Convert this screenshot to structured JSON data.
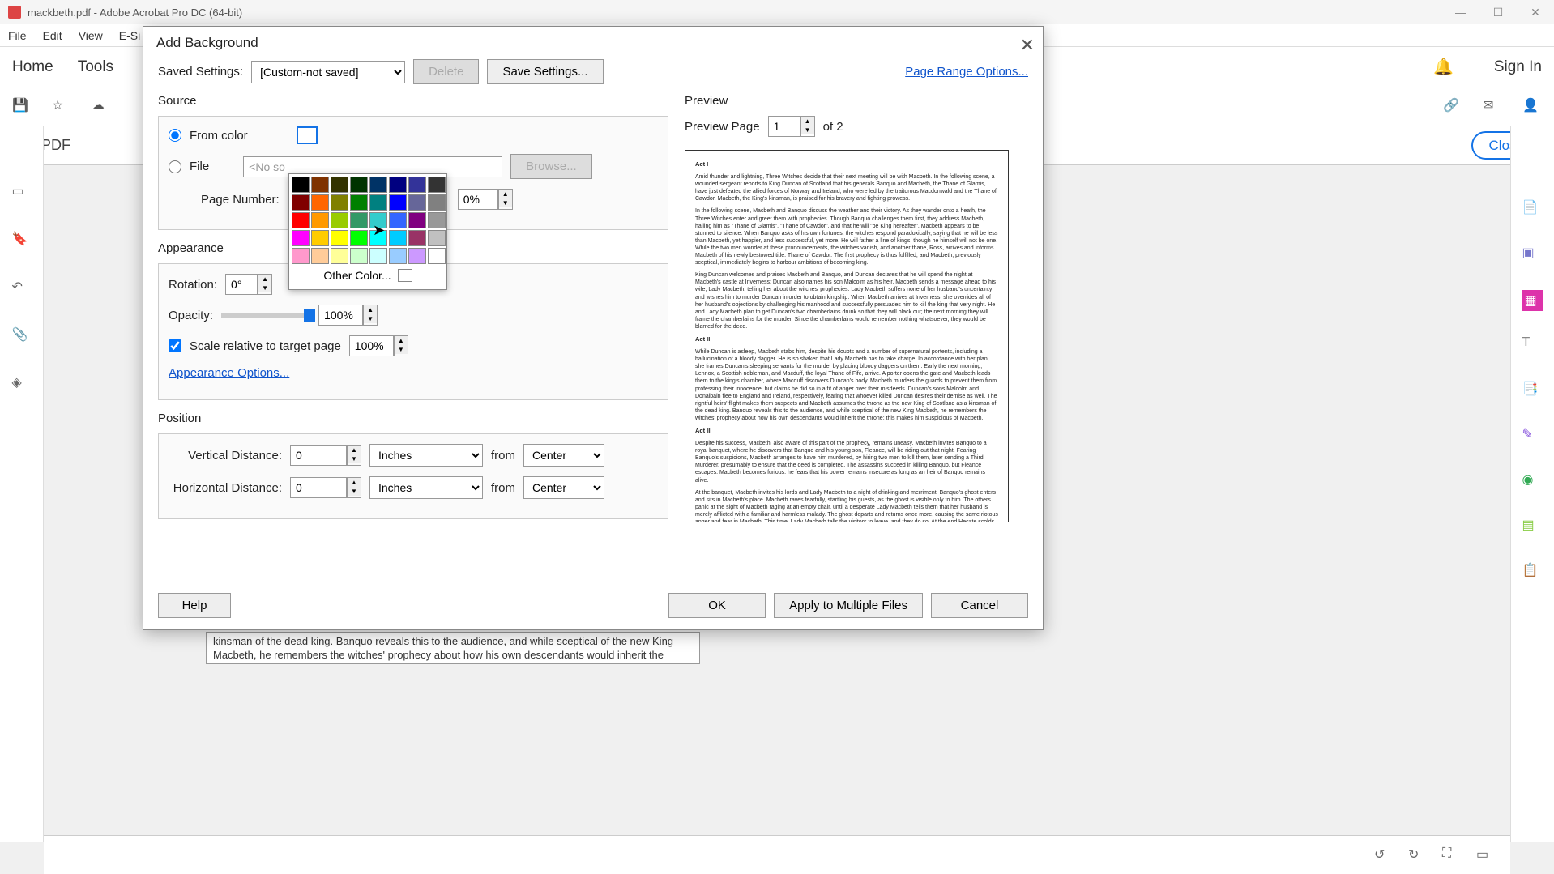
{
  "titlebar": {
    "title": "mackbeth.pdf - Adobe Acrobat Pro DC (64-bit)"
  },
  "menubar": {
    "file": "File",
    "edit": "Edit",
    "view": "View",
    "esign": "E-Si"
  },
  "tabbar": {
    "home": "Home",
    "tools": "Tools",
    "signin": "Sign In"
  },
  "editbar": {
    "label": "Edit PDF",
    "close": "Close"
  },
  "dialog": {
    "title": "Add Background",
    "saved_settings_label": "Saved Settings:",
    "saved_settings_value": "[Custom-not saved]",
    "delete": "Delete",
    "save_settings": "Save Settings...",
    "page_range": "Page Range Options...",
    "source": {
      "label": "Source",
      "from_color": "From color",
      "file": "File",
      "file_value": "<No so",
      "browse": "Browse...",
      "page_number_label": "Page Number:",
      "page_number_pct": "0%"
    },
    "appearance": {
      "label": "Appearance",
      "rotation_label": "Rotation:",
      "rotation_value": "0°",
      "opacity_label": "Opacity:",
      "opacity_value": "100%",
      "scale_label": "Scale relative to target page",
      "scale_value": "100%",
      "options": "Appearance Options..."
    },
    "position": {
      "label": "Position",
      "vdist_label": "Vertical Distance:",
      "vdist_value": "0",
      "hdist_label": "Horizontal Distance:",
      "hdist_value": "0",
      "unit": "Inches",
      "from": "from",
      "origin": "Center"
    },
    "help": "Help",
    "ok": "OK",
    "apply_multi": "Apply to Multiple Files",
    "cancel": "Cancel",
    "preview": {
      "label": "Preview",
      "page_label": "Preview Page",
      "page_value": "1",
      "of": "of 2"
    }
  },
  "colorpicker": {
    "other": "Other Color...",
    "rows": [
      [
        "#000000",
        "#7f3300",
        "#333300",
        "#003300",
        "#003366",
        "#000080",
        "#333399",
        "#333333"
      ],
      [
        "#800000",
        "#ff6600",
        "#808000",
        "#008000",
        "#008080",
        "#0000ff",
        "#666699",
        "#808080"
      ],
      [
        "#ff0000",
        "#ff9900",
        "#99cc00",
        "#339966",
        "#33cccc",
        "#3366ff",
        "#800080",
        "#999999"
      ],
      [
        "#ff00ff",
        "#ffcc00",
        "#ffff00",
        "#00ff00",
        "#00ffff",
        "#00ccff",
        "#993366",
        "#c0c0c0"
      ],
      [
        "#ff99cc",
        "#ffcc99",
        "#ffff99",
        "#ccffcc",
        "#ccffff",
        "#99ccff",
        "#cc99ff",
        "#ffffff"
      ]
    ]
  },
  "preview_doc": {
    "act1_h": "Act I",
    "act1_p1": "Amid thunder and lightning, Three Witches decide that their next meeting will be with Macbeth. In the following scene, a wounded sergeant reports to King Duncan of Scotland that his generals Banquo and Macbeth, the Thane of Glamis, have just defeated the allied forces of Norway and Ireland, who were led by the traitorous Macdonwald and the Thane of Cawdor. Macbeth, the King's kinsman, is praised for his bravery and fighting prowess.",
    "act1_p2": "In the following scene, Macbeth and Banquo discuss the weather and their victory. As they wander onto a heath, the Three Witches enter and greet them with prophecies. Though Banquo challenges them first, they address Macbeth, hailing him as \"Thane of Glamis\", \"Thane of Cawdor\", and that he will \"be King hereafter\". Macbeth appears to be stunned to silence. When Banquo asks of his own fortunes, the witches respond paradoxically, saying that he will be less than Macbeth, yet happier, and less successful, yet more. He will father a line of kings, though he himself will not be one. While the two men wonder at these pronouncements, the witches vanish, and another thane, Ross, arrives and informs Macbeth of his newly bestowed title: Thane of Cawdor. The first prophecy is thus fulfilled, and Macbeth, previously sceptical, immediately begins to harbour ambitions of becoming king.",
    "act1_p3": "King Duncan welcomes and praises Macbeth and Banquo, and Duncan declares that he will spend the night at Macbeth's castle at Inverness; Duncan also names his son Malcolm as his heir. Macbeth sends a message ahead to his wife, Lady Macbeth, telling her about the witches' prophecies. Lady Macbeth suffers none of her husband's uncertainty and wishes him to murder Duncan in order to obtain kingship. When Macbeth arrives at Inverness, she overrides all of her husband's objections by challenging his manhood and successfully persuades him to kill the king that very night. He and Lady Macbeth plan to get Duncan's two chamberlains drunk so that they will black out; the next morning they will frame the chamberlains for the murder. Since the chamberlains would remember nothing whatsoever, they would be blamed for the deed.",
    "act2_h": "Act II",
    "act2_p1": "While Duncan is asleep, Macbeth stabs him, despite his doubts and a number of supernatural portents, including a hallucination of a bloody dagger. He is so shaken that Lady Macbeth has to take charge. In accordance with her plan, she frames Duncan's sleeping servants for the murder by placing bloody daggers on them. Early the next morning, Lennox, a Scottish nobleman, and Macduff, the loyal Thane of Fife, arrive. A porter opens the gate and Macbeth leads them to the king's chamber, where Macduff discovers Duncan's body. Macbeth murders the guards to prevent them from professing their innocence, but claims he did so in a fit of anger over their misdeeds. Duncan's sons Malcolm and Donalbain flee to England and Ireland, respectively, fearing that whoever killed Duncan desires their demise as well. The rightful heirs' flight makes them suspects and Macbeth assumes the throne as the new King of Scotland as a kinsman of the dead king. Banquo reveals this to the audience, and while sceptical of the new King Macbeth, he remembers the witches' prophecy about how his own descendants would inherit the throne; this makes him suspicious of Macbeth.",
    "act3_h": "Act III",
    "act3_p1": "Despite his success, Macbeth, also aware of this part of the prophecy, remains uneasy. Macbeth invites Banquo to a royal banquet, where he discovers that Banquo and his young son, Fleance, will be riding out that night. Fearing Banquo's suspicions, Macbeth arranges to have him murdered, by hiring two men to kill them, later sending a Third Murderer, presumably to ensure that the deed is completed. The assassins succeed in killing Banquo, but Fleance escapes. Macbeth becomes furious: he fears that his power remains insecure as long as an heir of Banquo remains alive.",
    "act3_p2": "At the banquet, Macbeth invites his lords and Lady Macbeth to a night of drinking and merriment. Banquo's ghost enters and sits in Macbeth's place. Macbeth raves fearfully, startling his guests, as the ghost is visible only to him. The others panic at the sight of Macbeth raging at an empty chair, until a desperate Lady Macbeth tells them that her husband is merely afflicted with a familiar and harmless malady. The ghost departs and returns once more, causing the same riotous anger and fear in Macbeth. This time, Lady Macbeth tells the visitors to leave, and they do so. At the end Hecate scolds the three weird sisters for helping Macbeth, especially without consulting her. Hecate instructs the Witches to give Macbeth false security. Note that some scholars believe the Hecate scene was added in later."
  },
  "doc_behind": "kinsman of the dead king. Banquo reveals this to the audience, and while sceptical of the new King Macbeth, he remembers the witches' prophecy about how his own descendants would inherit the throne; this makes him suspicious"
}
